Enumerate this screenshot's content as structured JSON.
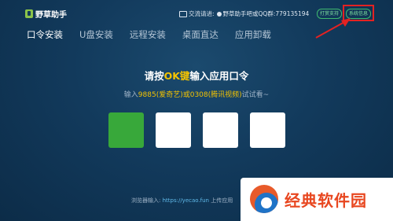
{
  "app": {
    "name": "野草助手"
  },
  "header": {
    "contact_label": "交流请进:",
    "group_text": "野草助手吧或QQ群:",
    "qq_number": "779135194",
    "support_button": "打赏支持",
    "sysinfo_button": "系统信息"
  },
  "tabs": [
    {
      "label": "口令安装",
      "active": true
    },
    {
      "label": "U盘安装",
      "active": false
    },
    {
      "label": "远程安装",
      "active": false
    },
    {
      "label": "桌面直达",
      "active": false
    },
    {
      "label": "应用卸载",
      "active": false
    }
  ],
  "main": {
    "title_prefix": "请按",
    "title_key": "OK键",
    "title_suffix": "输入应用口令",
    "hint_prefix": "输入",
    "hint_code": "9885(爱奇艺)或0308(腾讯视频)",
    "hint_suffix": "试试看~",
    "code_slots": [
      "",
      "",
      "",
      ""
    ]
  },
  "footer": {
    "label": "浏览器输入:",
    "url": "https://yecao.fun",
    "suffix": "上传应用"
  },
  "watermark": {
    "text": "经典软件园"
  },
  "colors": {
    "background": "#123a5c",
    "highlight": "#f5c400",
    "active_slot": "#38a83a",
    "annotation": "#e32222"
  }
}
